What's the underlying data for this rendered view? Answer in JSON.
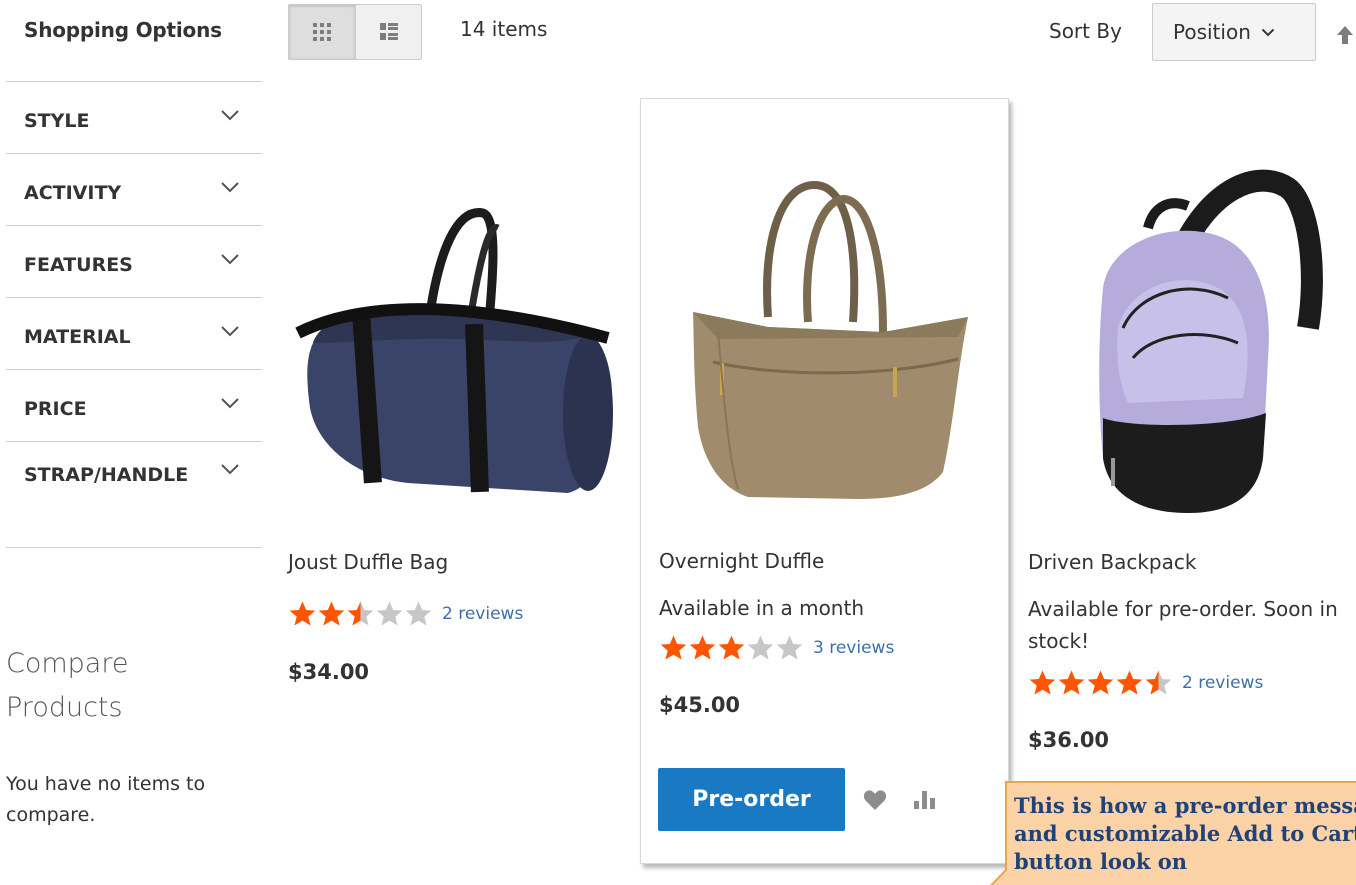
{
  "sidebar": {
    "title": "Shopping Options",
    "filters": [
      {
        "label": "STYLE"
      },
      {
        "label": "ACTIVITY"
      },
      {
        "label": "FEATURES"
      },
      {
        "label": "MATERIAL"
      },
      {
        "label": "PRICE"
      },
      {
        "label": "STRAP/HANDLE"
      }
    ],
    "compare": {
      "title": "Compare Products",
      "empty_text": "You have no items to compare."
    }
  },
  "toolbar": {
    "view_modes": [
      {
        "name": "grid",
        "icon": "grid-icon",
        "active": true
      },
      {
        "name": "list",
        "icon": "list-icon",
        "active": false
      }
    ],
    "amount": "14 items",
    "sort_label": "Sort By",
    "sort_value": "Position",
    "sort_direction_icon": "arrow-up-icon"
  },
  "products": [
    {
      "name": "Joust Duffle Bag",
      "note": "",
      "rating_percent": 50,
      "reviews": "2 reviews",
      "price": "$34.00"
    },
    {
      "name": "Overnight Duffle",
      "note": "Available in a month",
      "rating_percent": 60,
      "reviews": "3 reviews",
      "price": "$45.00",
      "button_label": "Pre-order"
    },
    {
      "name": "Driven Backpack",
      "note": "Available for pre-order. Soon in stock!",
      "rating_percent": 90,
      "reviews": "2 reviews",
      "price": "$36.00"
    }
  ],
  "callout": {
    "text": "This is how a pre-order message and customizable Add to Cart button look on"
  },
  "colors": {
    "star_filled": "#ff5501",
    "star_empty": "#c7c7c7",
    "button_primary": "#1979c3",
    "link": "#3f6fa8",
    "callout_bg": "#fcd2a7",
    "callout_border": "#f0a24a",
    "callout_text": "#1f4278"
  }
}
